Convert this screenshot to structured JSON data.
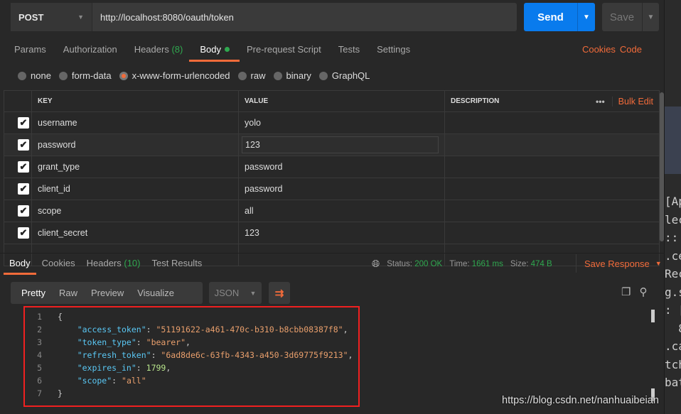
{
  "request": {
    "method": "POST",
    "url": "http://localhost:8080/oauth/token",
    "send_label": "Send",
    "save_label": "Save"
  },
  "tabs": [
    {
      "label": "Params"
    },
    {
      "label": "Authorization"
    },
    {
      "label": "Headers",
      "count": "(8)"
    },
    {
      "label": "Body",
      "active": true
    },
    {
      "label": "Pre-request Script"
    },
    {
      "label": "Tests"
    },
    {
      "label": "Settings"
    }
  ],
  "links": {
    "cookies": "Cookies",
    "code": "Code"
  },
  "body_types": [
    "none",
    "form-data",
    "x-www-form-urlencoded",
    "raw",
    "binary",
    "GraphQL"
  ],
  "body_type_selected": "x-www-form-urlencoded",
  "table": {
    "headers": [
      "KEY",
      "VALUE",
      "DESCRIPTION"
    ],
    "bulk_edit": "Bulk Edit",
    "more": "•••",
    "rows": [
      {
        "key": "username",
        "value": "yolo",
        "checked": true
      },
      {
        "key": "password",
        "value": "123",
        "checked": true
      },
      {
        "key": "grant_type",
        "value": "password",
        "checked": true
      },
      {
        "key": "client_id",
        "value": "password",
        "checked": true
      },
      {
        "key": "scope",
        "value": "all",
        "checked": true
      },
      {
        "key": "client_secret",
        "value": "123",
        "checked": true
      }
    ]
  },
  "response": {
    "tabs": [
      {
        "label": "Body"
      },
      {
        "label": "Cookies"
      },
      {
        "label": "Headers",
        "count": "(10)"
      },
      {
        "label": "Test Results"
      }
    ],
    "status_label": "Status:",
    "status": "200 OK",
    "time_label": "Time:",
    "time": "1661 ms",
    "size_label": "Size:",
    "size": "474 B",
    "save_response": "Save Response",
    "views": [
      "Pretty",
      "Raw",
      "Preview",
      "Visualize"
    ],
    "format": "JSON",
    "code": [
      {
        "n": "1",
        "t": [
          [
            "p",
            "{"
          ]
        ]
      },
      {
        "n": "2",
        "t": [
          [
            "k",
            "    \"access_token\""
          ],
          [
            "p",
            ": "
          ],
          [
            "s",
            "\"51191622-a461-470c-b310-b8cbb08387f8\""
          ],
          [
            "p",
            ","
          ]
        ]
      },
      {
        "n": "3",
        "t": [
          [
            "k",
            "    \"token_type\""
          ],
          [
            "p",
            ": "
          ],
          [
            "s",
            "\"bearer\""
          ],
          [
            "p",
            ","
          ]
        ]
      },
      {
        "n": "4",
        "t": [
          [
            "k",
            "    \"refresh_token\""
          ],
          [
            "p",
            ": "
          ],
          [
            "s",
            "\"6ad8de6c-63fb-4343-a450-3d69775f9213\""
          ],
          [
            "p",
            ","
          ]
        ]
      },
      {
        "n": "5",
        "t": [
          [
            "k",
            "    \"expires_in\""
          ],
          [
            "p",
            ": "
          ],
          [
            "n",
            "1799"
          ],
          [
            "p",
            ","
          ]
        ]
      },
      {
        "n": "6",
        "t": [
          [
            "k",
            "    \"scope\""
          ],
          [
            "p",
            ": "
          ],
          [
            "s",
            "\"all\""
          ]
        ]
      },
      {
        "n": "7",
        "t": [
          [
            "p",
            "}"
          ]
        ]
      }
    ]
  },
  "background_ide_fragments": [
    "[Ap",
    "lec",
    "::",
    ".ce",
    "Rec",
    "g.s",
    ": [",
    "  8",
    ".ca",
    "tch",
    "bat"
  ],
  "watermark": "https://blog.csdn.net/nanhuaibeian",
  "colors": {
    "accent": "#f26b3a",
    "send": "#097bed",
    "success": "#2fa84f",
    "highlight_box": "#f02020"
  }
}
